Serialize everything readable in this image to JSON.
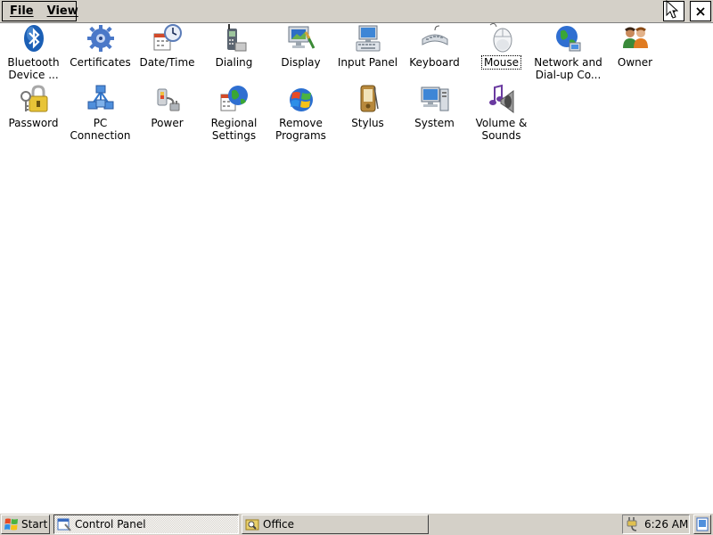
{
  "menubar": {
    "items": [
      {
        "label": "File"
      },
      {
        "label": "View"
      }
    ],
    "help_icon": "help-question-icon",
    "close_label": "×"
  },
  "control_panel": {
    "items": [
      {
        "id": "bluetooth",
        "label": "Bluetooth\nDevice ...",
        "icon": "bluetooth-icon"
      },
      {
        "id": "certificates",
        "label": "Certificates",
        "icon": "gear-icon"
      },
      {
        "id": "datetime",
        "label": "Date/Time",
        "icon": "clock-calendar-icon"
      },
      {
        "id": "dialing",
        "label": "Dialing",
        "icon": "phone-icon"
      },
      {
        "id": "display",
        "label": "Display",
        "icon": "monitor-brush-icon"
      },
      {
        "id": "input-panel",
        "label": "Input Panel",
        "icon": "keyboard-monitor-icon"
      },
      {
        "id": "keyboard",
        "label": "Keyboard",
        "icon": "keyboard-icon"
      },
      {
        "id": "mouse",
        "label": "Mouse",
        "icon": "mouse-icon",
        "selected": true
      },
      {
        "id": "network",
        "label": "Network and\nDial-up Co...",
        "icon": "globe-network-icon"
      },
      {
        "id": "owner",
        "label": "Owner",
        "icon": "people-icon"
      },
      {
        "id": "password",
        "label": "Password",
        "icon": "key-lock-icon"
      },
      {
        "id": "pc-connection",
        "label": "PC\nConnection",
        "icon": "network-computers-icon"
      },
      {
        "id": "power",
        "label": "Power",
        "icon": "power-plug-icon"
      },
      {
        "id": "regional",
        "label": "Regional\nSettings",
        "icon": "globe-calendar-icon"
      },
      {
        "id": "remove-programs",
        "label": "Remove\nPrograms",
        "icon": "windows-flag-icon"
      },
      {
        "id": "stylus",
        "label": "Stylus",
        "icon": "stylus-device-icon"
      },
      {
        "id": "system",
        "label": "System",
        "icon": "computer-icon"
      },
      {
        "id": "volume",
        "label": "Volume &\nSounds",
        "icon": "speaker-note-icon"
      }
    ]
  },
  "taskbar": {
    "start_label": "Start",
    "tasks": [
      {
        "label": "Control Panel",
        "active": true
      },
      {
        "label": "Office",
        "active": false
      }
    ],
    "clock": "6:26 AM"
  },
  "colors": {
    "chrome": "#d4d0c8",
    "window_bg": "#ffffff",
    "xp_blue": "#2f6fd1",
    "xp_green": "#3aa635"
  }
}
